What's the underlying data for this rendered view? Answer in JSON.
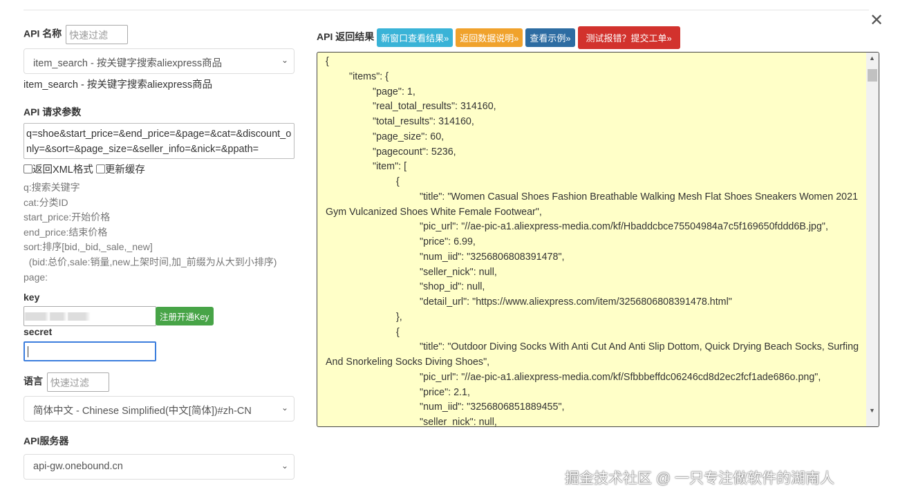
{
  "api_name": {
    "label": "API 名称",
    "filter_placeholder": "快速过滤",
    "selected": "item_search - 按关键字搜索aliexpress商品",
    "description": "item_search - 按关键字搜索aliexpress商品"
  },
  "params": {
    "label": "API 请求参数",
    "value": "q=shoe&start_price=&end_price=&page=&cat=&discount_only=&sort=&page_size=&seller_info=&nick=&ppath=",
    "xml_label": "返回XML格式",
    "cache_label": "更新缓存",
    "hints": [
      "q:搜索关键字",
      "cat:分类ID",
      "start_price:开始价格",
      "end_price:结束价格",
      "sort:排序[bid,_bid,_sale,_new]",
      "  (bid:总价,sale:销量,new上架时间,加_前缀为从大到小排序)",
      "page:"
    ]
  },
  "key": {
    "label": "key",
    "register_button": "注册开通Key"
  },
  "secret": {
    "label": "secret"
  },
  "language": {
    "label": "语言",
    "filter_placeholder": "快速过滤",
    "selected": "简体中文 - Chinese Simplified(中文[简体])#zh-CN"
  },
  "server": {
    "label": "API服务器",
    "selected": "api-gw.onebound.cn"
  },
  "result": {
    "label": "API 返回结果",
    "buttons": [
      {
        "label": "新窗口查看结果»",
        "color": "#39b3d7"
      },
      {
        "label": "返回数据说明»",
        "color": "#f0a22c"
      },
      {
        "label": "查看示例»",
        "color": "#2d6ca2"
      },
      {
        "label": "测试报错？提交工单»",
        "color": "#d2322d"
      }
    ],
    "json": "{\n\t\"items\": {\n\t\t\"page\": 1,\n\t\t\"real_total_results\": 314160,\n\t\t\"total_results\": 314160,\n\t\t\"page_size\": 60,\n\t\t\"pagecount\": 5236,\n\t\t\"item\": [\n\t\t\t{\n\t\t\t\t\"title\": \"Women Casual Shoes Fashion Breathable Walking Mesh Flat Shoes Sneakers Women 2021 Gym Vulcanized Shoes White Female Footwear\",\n\t\t\t\t\"pic_url\": \"//ae-pic-a1.aliexpress-media.com/kf/Hbaddcbce75504984a7c5f169650fddd6B.jpg\",\n\t\t\t\t\"price\": 6.99,\n\t\t\t\t\"num_iid\": \"3256806808391478\",\n\t\t\t\t\"seller_nick\": null,\n\t\t\t\t\"shop_id\": null,\n\t\t\t\t\"detail_url\": \"https://www.aliexpress.com/item/3256806808391478.html\"\n\t\t\t},\n\t\t\t{\n\t\t\t\t\"title\": \"Outdoor Diving Socks With Anti Cut And Anti Slip Dottom, Quick Drying Beach Socks, Surfing And Snorkeling Socks Diving Shoes\",\n\t\t\t\t\"pic_url\": \"//ae-pic-a1.aliexpress-media.com/kf/Sfbbbeffdc06246cd8d2ec2fcf1ade686o.png\",\n\t\t\t\t\"price\": 2.1,\n\t\t\t\t\"num_iid\": \"3256806851889455\",\n\t\t\t\t\"seller_nick\": null,"
  },
  "watermark": "掘金技术社区 @ 一只专注做软件的湖南人"
}
